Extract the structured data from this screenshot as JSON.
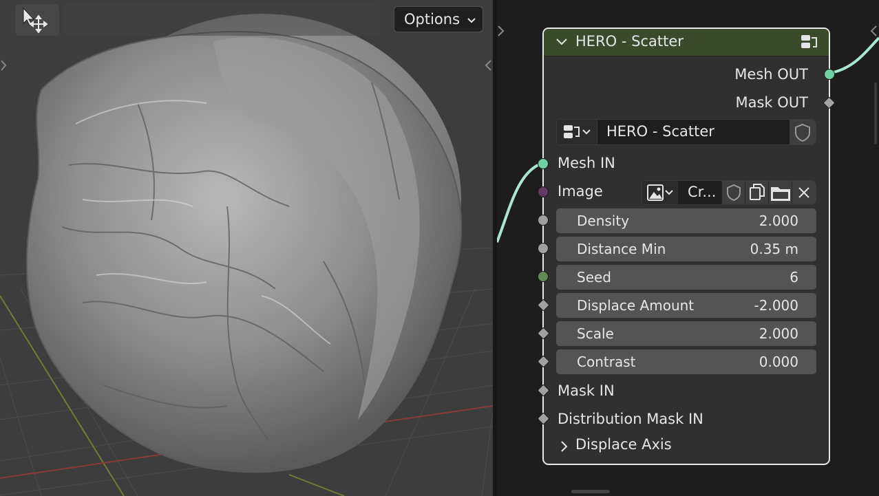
{
  "viewport": {
    "options_label": "Options",
    "tool_icon": "move-cursor-icon"
  },
  "node": {
    "title": "HERO - Scatter",
    "header_color": "#3a4a2b",
    "outputs": [
      {
        "label": "Mesh OUT",
        "socket_color": "#6fd1a4"
      },
      {
        "label": "Mask OUT",
        "socket_color": "#a3a3a3"
      }
    ],
    "group_selector": {
      "name": "HERO - Scatter"
    },
    "inputs": {
      "mesh_in": {
        "label": "Mesh IN",
        "socket_color": "#6fd1a4"
      },
      "image": {
        "label": "Image",
        "socket_color": "#633863",
        "selector_name": "Cr..."
      }
    },
    "fields": [
      {
        "label": "Density",
        "value": "2.000"
      },
      {
        "label": "Distance Min",
        "value": "0.35 m"
      },
      {
        "label": "Seed",
        "value": "6"
      },
      {
        "label": "Displace Amount",
        "value": "-2.000"
      },
      {
        "label": "Scale",
        "value": "2.000"
      },
      {
        "label": "Contrast",
        "value": "0.000"
      }
    ],
    "mask_in": {
      "label": "Mask IN"
    },
    "distribution_mask_in": {
      "label": "Distribution Mask IN"
    },
    "panel": {
      "label": "Displace Axis"
    }
  },
  "colors": {
    "link": "#a9e8cf",
    "node_border": "#e9e9e9",
    "field_bg": "#545454"
  }
}
